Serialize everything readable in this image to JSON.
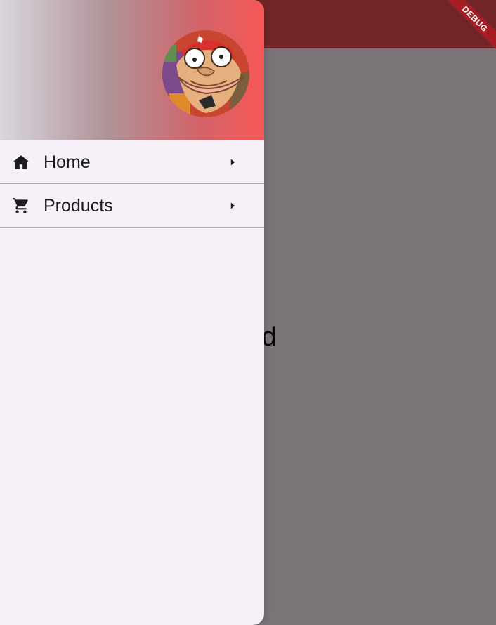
{
  "app": {
    "appbar_color": "#722528",
    "scrim_color": "#787478",
    "body_text_visible": "Walid"
  },
  "debug_banner": {
    "label": "DEBUG"
  },
  "drawer": {
    "header": {
      "gradient_colors": [
        "#dad6de",
        "#f85656"
      ],
      "avatar_icon": "avatar-cartoon-character"
    },
    "items": [
      {
        "label": "Home",
        "icon": "home-icon",
        "trailing_icon": "arrow-right-icon"
      },
      {
        "label": "Products",
        "icon": "shopping-cart-icon",
        "trailing_icon": "arrow-right-icon"
      }
    ],
    "divider_color": "#f08c8c",
    "background": "#f6f1f9"
  }
}
